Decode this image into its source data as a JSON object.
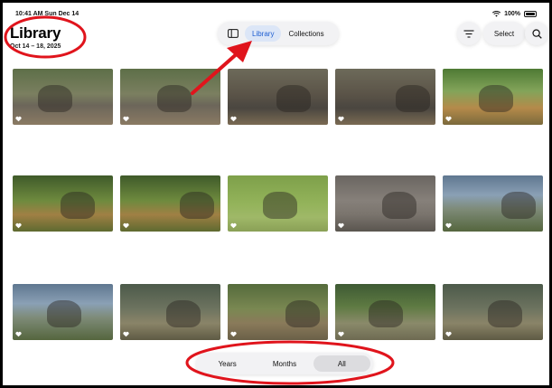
{
  "status": {
    "time": "10:41 AM  Sun Dec 14",
    "battery": "100%"
  },
  "header": {
    "title": "Library",
    "date_range": "Oct 14 – 18, 2025",
    "tabs": [
      {
        "label": "Library",
        "active": true
      },
      {
        "label": "Collections",
        "active": false
      }
    ],
    "select_label": "Select"
  },
  "icons": {
    "sidebar": "sidebar-toggle-icon",
    "filter": "filter-lines-icon",
    "search": "search-icon",
    "favorite": "heart-icon"
  },
  "photos": [
    {
      "subject": "elephants",
      "favorite": true
    },
    {
      "subject": "elephants",
      "favorite": true
    },
    {
      "subject": "elephant",
      "favorite": true
    },
    {
      "subject": "elephant",
      "favorite": true
    },
    {
      "subject": "giraffes",
      "favorite": true
    },
    {
      "subject": "giraffe",
      "favorite": true
    },
    {
      "subject": "giraffe",
      "favorite": true
    },
    {
      "subject": "pelican",
      "favorite": true
    },
    {
      "subject": "chimpanzee",
      "favorite": true
    },
    {
      "subject": "ostrich",
      "favorite": true
    },
    {
      "subject": "ostrich",
      "favorite": true
    },
    {
      "subject": "antelope",
      "favorite": true
    },
    {
      "subject": "antelopes",
      "favorite": true
    },
    {
      "subject": "deer",
      "favorite": true
    },
    {
      "subject": "antelope",
      "favorite": true
    }
  ],
  "bottom_bar": {
    "options": [
      {
        "label": "Years",
        "active": false
      },
      {
        "label": "Months",
        "active": false
      },
      {
        "label": "All",
        "active": true
      }
    ]
  },
  "colors": {
    "accent": "#1f5fd1",
    "annotation": "#e0141c"
  }
}
